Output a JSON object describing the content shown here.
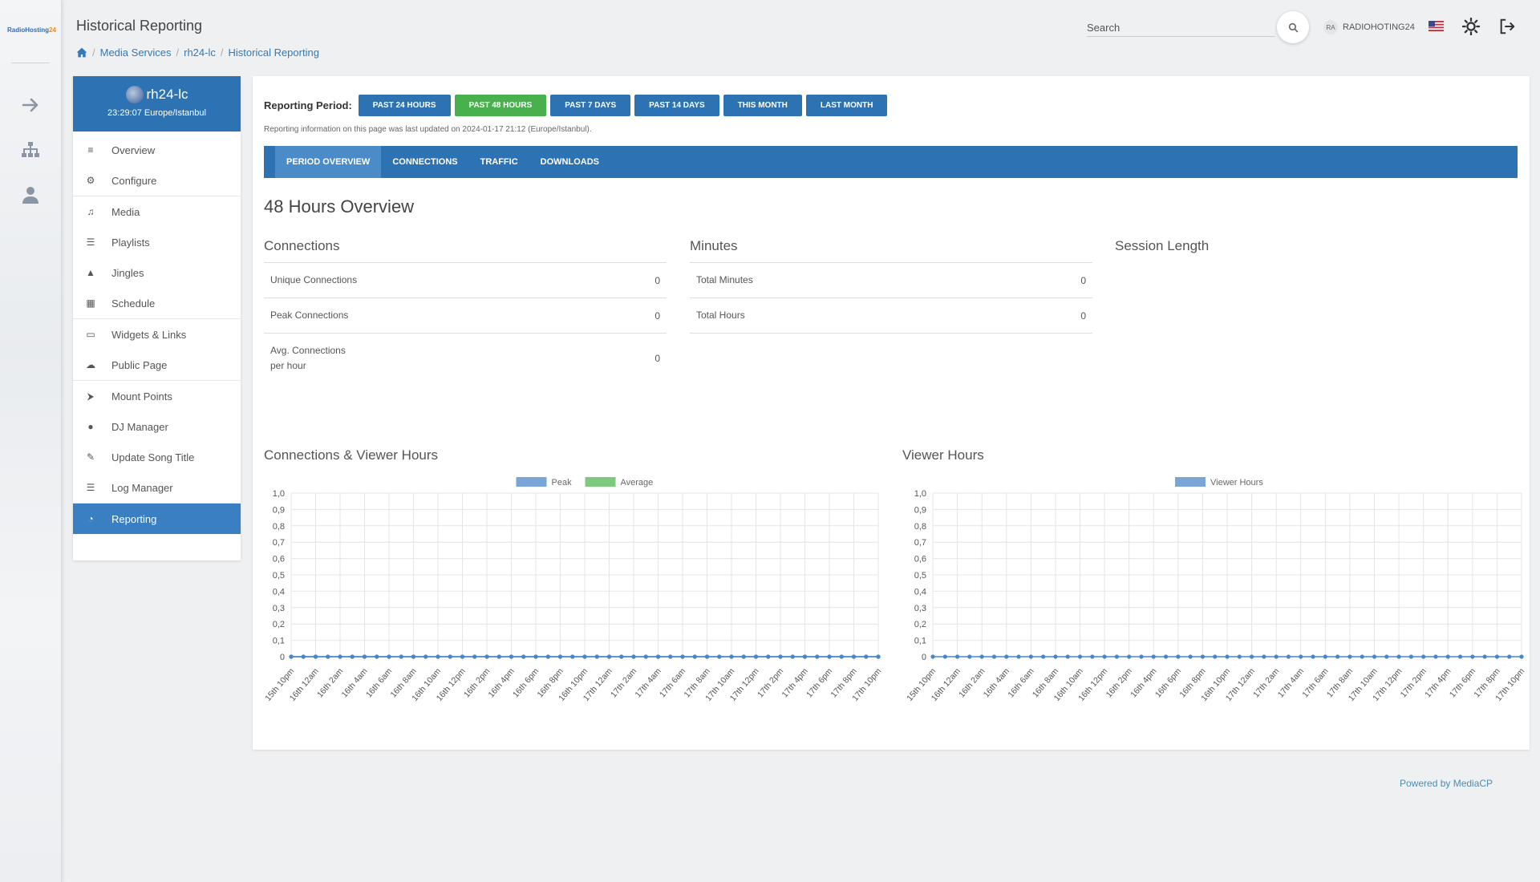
{
  "app": {
    "logo_main": "RadioHosting",
    "logo_accent": "24"
  },
  "header": {
    "title": "Historical Reporting",
    "breadcrumb": [
      "Media Services",
      "rh24-lc",
      "Historical Reporting"
    ],
    "search_placeholder": "Search",
    "user_initials": "RA",
    "username": "RADIOHOTING24"
  },
  "station": {
    "name": "rh24-lc",
    "time": "23:29:07 Europe/Istanbul",
    "menu": [
      {
        "label": "Overview",
        "icon": "bars-icon"
      },
      {
        "label": "Configure",
        "icon": "cogs-icon"
      },
      {
        "label": "Media",
        "icon": "music-icon"
      },
      {
        "label": "Playlists",
        "icon": "list-icon"
      },
      {
        "label": "Jingles",
        "icon": "bell-icon"
      },
      {
        "label": "Schedule",
        "icon": "calendar-icon"
      },
      {
        "label": "Widgets & Links",
        "icon": "laptop-icon"
      },
      {
        "label": "Public Page",
        "icon": "cloud-icon"
      },
      {
        "label": "Mount Points",
        "icon": "sitemap-icon"
      },
      {
        "label": "DJ Manager",
        "icon": "user-icon"
      },
      {
        "label": "Update Song Title",
        "icon": "edit-icon"
      },
      {
        "label": "Log Manager",
        "icon": "list-icon"
      },
      {
        "label": "Reporting",
        "icon": "pie-chart-icon"
      }
    ]
  },
  "reporting": {
    "period_label": "Reporting Period:",
    "periods": [
      "PAST 24 HOURS",
      "PAST 48 HOURS",
      "PAST 7 DAYS",
      "PAST 14 DAYS",
      "THIS MONTH",
      "LAST MONTH"
    ],
    "active_period": "PAST 48 HOURS",
    "updated_note": "Reporting information on this page was last updated on 2024-01-17 21:12 (Europe/Istanbul).",
    "tabs": [
      "PERIOD OVERVIEW",
      "CONNECTIONS",
      "TRAFFIC",
      "DOWNLOADS"
    ],
    "active_tab": "PERIOD OVERVIEW",
    "overview_title": "48 Hours Overview",
    "connections": {
      "title": "Connections",
      "rows": [
        {
          "label": "Unique Connections",
          "value": "0"
        },
        {
          "label": "Peak Connections",
          "value": "0"
        },
        {
          "label": "Avg. Connections per hour",
          "value": "0"
        }
      ]
    },
    "minutes": {
      "title": "Minutes",
      "rows": [
        {
          "label": "Total Minutes",
          "value": "0"
        },
        {
          "label": "Total Hours",
          "value": "0"
        }
      ]
    },
    "session_length": {
      "title": "Session Length"
    }
  },
  "footer": {
    "powered_by": "Powered by MediaCP"
  },
  "colors": {
    "primary": "#2d73b4",
    "active_green": "#48b04d",
    "series_blue": "#7aa6d6",
    "series_green": "#7dc97f"
  },
  "chart_data": [
    {
      "type": "line",
      "title": "Connections & Viewer Hours",
      "legend_position": "top-center",
      "categories": [
        "15th 10pm",
        "16th 12am",
        "16th 2am",
        "16th 4am",
        "16th 6am",
        "16th 8am",
        "16th 10am",
        "16th 12pm",
        "16th 2pm",
        "16th 4pm",
        "16th 6pm",
        "16th 8pm",
        "16th 10pm",
        "17th 12am",
        "17th 2am",
        "17th 4am",
        "17th 6am",
        "17th 8am",
        "17th 10am",
        "17th 12pm",
        "17th 2pm",
        "17th 4pm",
        "17th 6pm",
        "17th 8pm",
        "17th 10pm"
      ],
      "point_count": 49,
      "series": [
        {
          "name": "Peak",
          "color": "#7aa6d6",
          "values_all": 0
        },
        {
          "name": "Average",
          "color": "#7dc97f",
          "values_all": 0
        }
      ],
      "yticks": [
        "1,0",
        "0,9",
        "0,8",
        "0,7",
        "0,6",
        "0,5",
        "0,4",
        "0,3",
        "0,2",
        "0,1",
        "0"
      ],
      "ylim": [
        0,
        1
      ],
      "grid": true
    },
    {
      "type": "line",
      "title": "Viewer Hours",
      "legend_position": "top-center",
      "categories": [
        "15th 10pm",
        "16th 12am",
        "16th 2am",
        "16th 4am",
        "16th 6am",
        "16th 8am",
        "16th 10am",
        "16th 12pm",
        "16th 2pm",
        "16th 4pm",
        "16th 6pm",
        "16th 8pm",
        "16th 10pm",
        "17th 12am",
        "17th 2am",
        "17th 4am",
        "17th 6am",
        "17th 8am",
        "17th 10am",
        "17th 12pm",
        "17th 2pm",
        "17th 4pm",
        "17th 6pm",
        "17th 8pm",
        "17th 10pm"
      ],
      "point_count": 49,
      "series": [
        {
          "name": "Viewer Hours",
          "color": "#7aa6d6",
          "values_all": 0
        }
      ],
      "yticks": [
        "1,0",
        "0,9",
        "0,8",
        "0,7",
        "0,6",
        "0,5",
        "0,4",
        "0,3",
        "0,2",
        "0,1",
        "0"
      ],
      "ylim": [
        0,
        1
      ],
      "grid": true
    }
  ]
}
